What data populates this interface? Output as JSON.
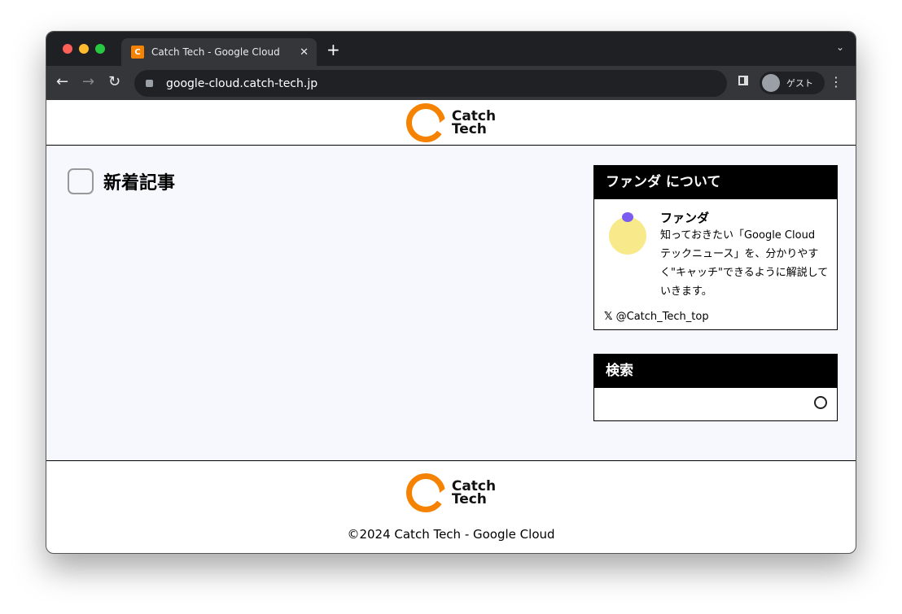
{
  "browser": {
    "tab_title": "Catch Tech - Google Cloud",
    "url": "google-cloud.catch-tech.jp",
    "profile": "ゲスト"
  },
  "header": {
    "logo_line1": "Catch",
    "logo_line2": "Tech"
  },
  "main": {
    "title": "新着記事"
  },
  "sidebar": {
    "about": {
      "title": "ファンダ について",
      "name": "ファンダ",
      "description": "知っておきたい「Google Cloud テックニュース」を、分かりやすく\"キャッチ\"できるように解説していきます。",
      "twitter": "@Catch_Tech_top"
    },
    "search": {
      "title": "検索",
      "placeholder": ""
    }
  },
  "footer": {
    "logo_line1": "Catch",
    "logo_line2": "Tech",
    "copyright": "©2024 Catch Tech - Google Cloud"
  },
  "colors": {
    "brand": "#f58200",
    "background": "#f7f8fe"
  }
}
